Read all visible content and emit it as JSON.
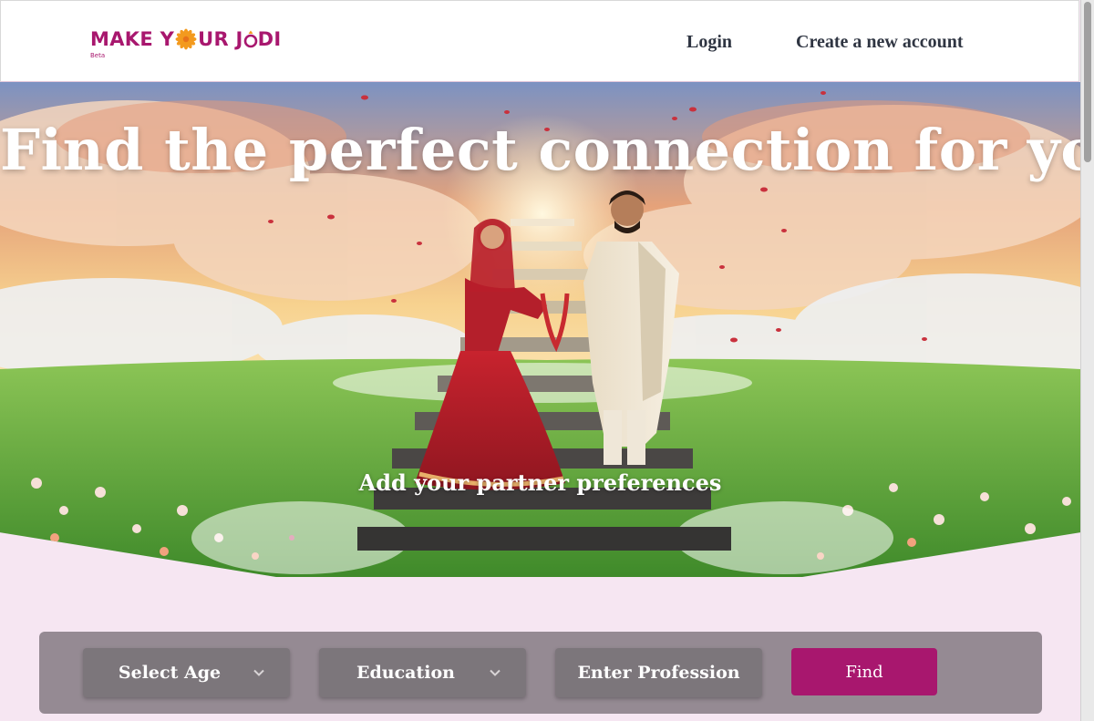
{
  "brand": {
    "name_part1": "MAKE Y",
    "name_part2": "UR J",
    "name_part3": "DI",
    "beta": "Beta",
    "accent_color": "#a8176e"
  },
  "nav": {
    "login": "Login",
    "create_account": "Create a new account"
  },
  "hero": {
    "title": "Find the perfect connection for you",
    "subtitle": "Add your partner preferences"
  },
  "filters": {
    "age": "Select Age",
    "education": "Education",
    "profession_placeholder": "Enter Profession",
    "find": "Find"
  },
  "icons": [
    "chevron-down-icon",
    "flower-icon",
    "ring-icon"
  ]
}
